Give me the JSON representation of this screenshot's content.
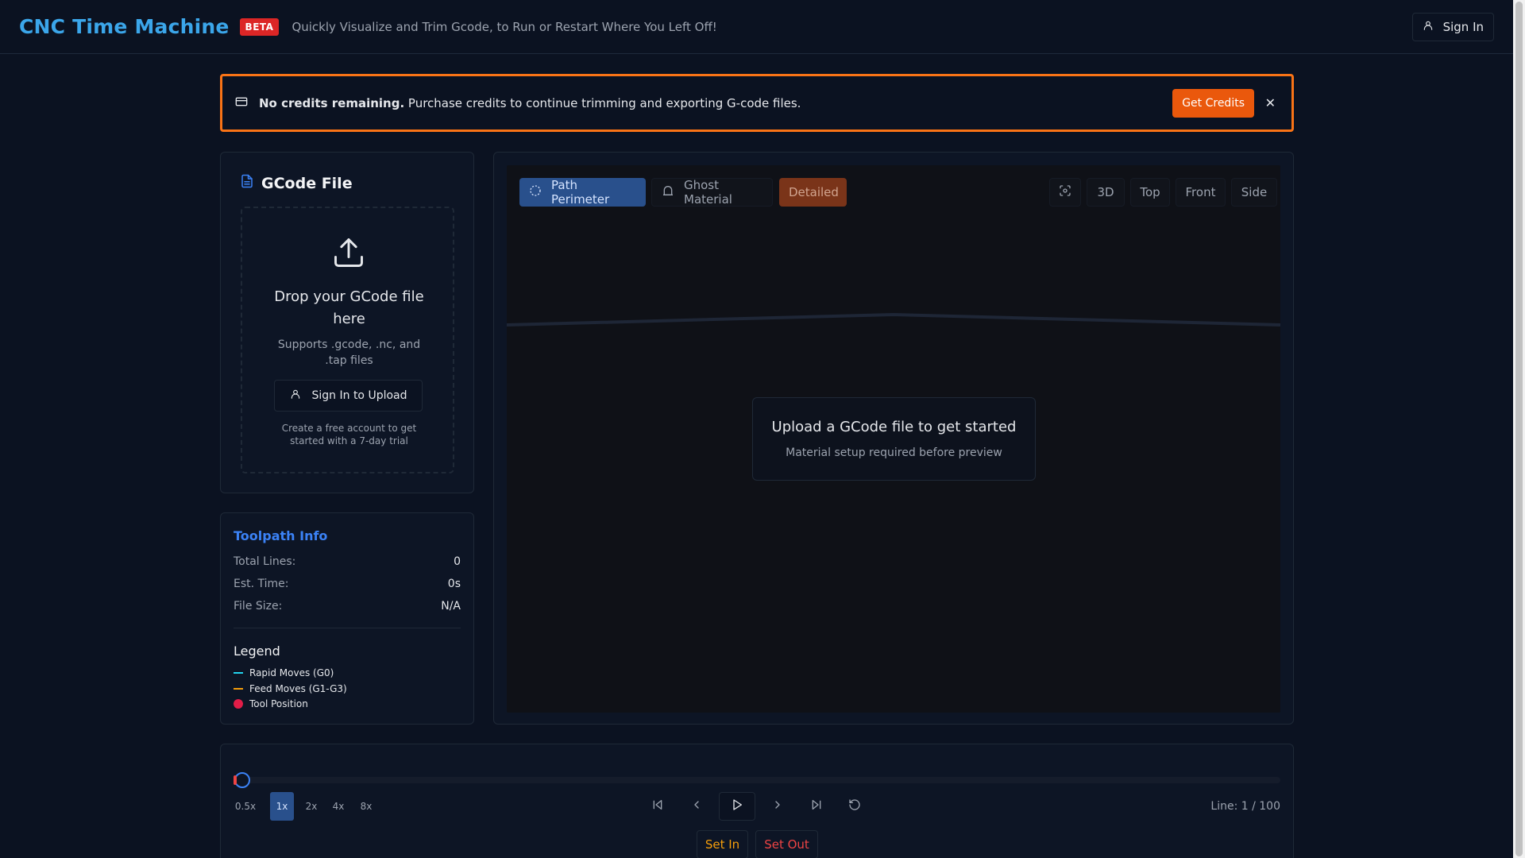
{
  "header": {
    "brand": "CNC Time Machine",
    "badge": "BETA",
    "tagline": "Quickly Visualize and Trim Gcode, to Run or Restart Where You Left Off!",
    "signin_label": "Sign In"
  },
  "alert": {
    "bold_text": "No credits remaining.",
    "text": " Purchase credits to continue trimming and exporting G-code files.",
    "button_label": "Get Credits",
    "close_glyph": "✕",
    "border_color": "#f97316"
  },
  "gcode_file": {
    "title": "GCode File",
    "drop_title": "Drop your GCode file here",
    "drop_sub": "Supports .gcode, .nc, and .tap files",
    "signin_upload_label": "Sign In to Upload",
    "note": "Create a free account to get started with a 7-day trial"
  },
  "toolpath_info": {
    "title": "Toolpath Info",
    "rows": [
      {
        "label": "Total Lines:",
        "value": "0"
      },
      {
        "label": "Est. Time:",
        "value": "0s"
      },
      {
        "label": "File Size:",
        "value": "N/A"
      }
    ],
    "legend_title": "Legend",
    "legend": [
      {
        "label": "Rapid Moves (G0)",
        "color": "#22d3ee",
        "shape": "line"
      },
      {
        "label": "Feed Moves (G1-G3)",
        "color": "#f59e0b",
        "shape": "line"
      },
      {
        "label": "Tool Position",
        "color": "#e11d48",
        "shape": "dot"
      }
    ]
  },
  "viewer": {
    "toggles": [
      {
        "label": "Path Perimeter",
        "icon": "loader-circle-icon",
        "state": "active"
      },
      {
        "label": "Ghost Material",
        "icon": "ghost-icon",
        "state": "inactive"
      },
      {
        "label": "Detailed",
        "state": "highlight"
      }
    ],
    "views": [
      {
        "label": "",
        "icon": "focus-icon"
      },
      {
        "label": "3D"
      },
      {
        "label": "Top"
      },
      {
        "label": "Front"
      },
      {
        "label": "Side"
      }
    ],
    "empty_title": "Upload a GCode file to get started",
    "empty_sub": "Material setup required before preview"
  },
  "playback": {
    "progress": 0,
    "speeds": [
      "0.5x",
      "1x",
      "2x",
      "4x",
      "8x"
    ],
    "active_speed": "1x",
    "controls": [
      "skip-back-icon",
      "chevron-left-icon",
      "play-icon",
      "chevron-right-icon",
      "skip-forward-icon",
      "rotate-ccw-icon"
    ],
    "line_status": "Line: 1 / 100",
    "set_in_label": "Set In",
    "set_out_label": "Set Out"
  }
}
